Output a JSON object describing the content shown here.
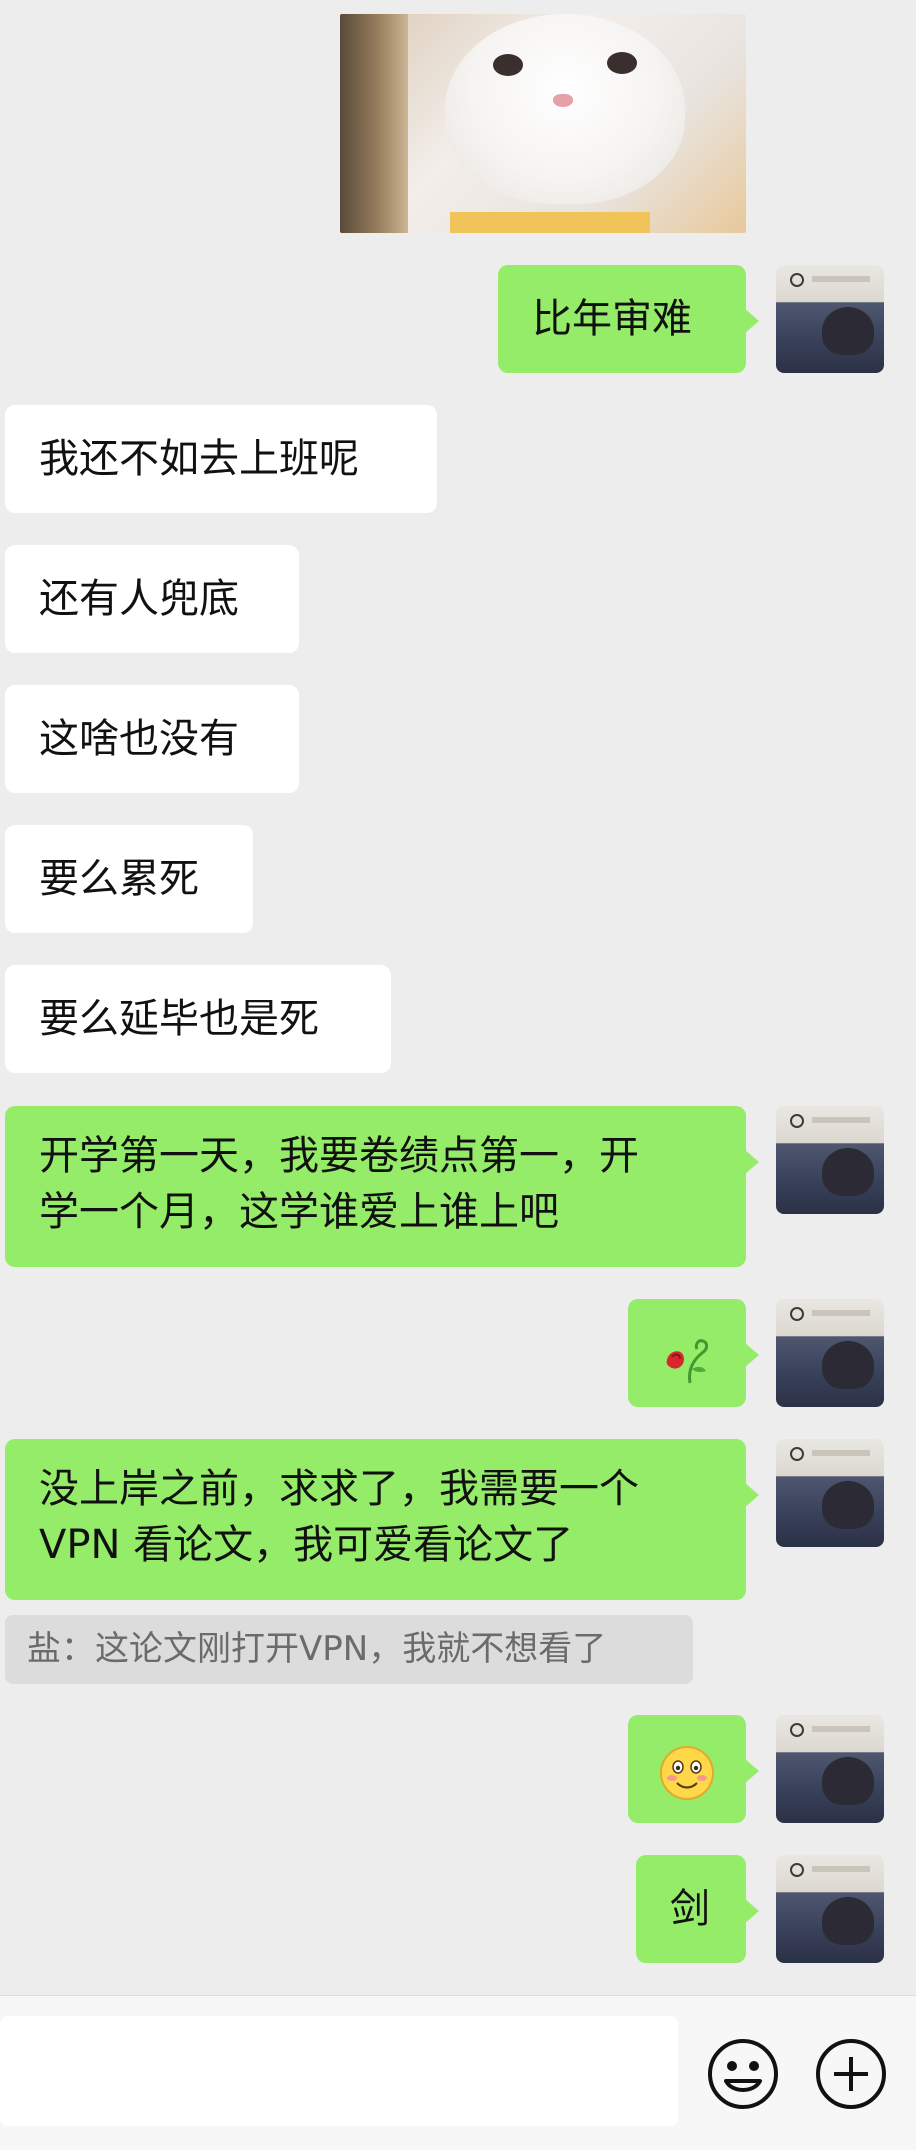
{
  "messages": [
    {
      "id": "m1",
      "text": "比年审难"
    },
    {
      "id": "m2",
      "text": "我还不如去上班呢"
    },
    {
      "id": "m3",
      "text": "还有人兜底"
    },
    {
      "id": "m4",
      "text": "这啥也没有"
    },
    {
      "id": "m5",
      "text": "要么累死"
    },
    {
      "id": "m6",
      "text": "要么延毕也是死"
    },
    {
      "id": "m7",
      "text": "开学第一天，我要卷绩点第一，开\n学一个月，这学谁爱上谁上吧"
    },
    {
      "id": "m8",
      "emoji": "wilted-rose"
    },
    {
      "id": "m9",
      "text": "没上岸之前，求求了，我需要一个\nVPN 看论文，我可爱看论文了"
    },
    {
      "id": "m10",
      "emoji": "flushed-smile"
    },
    {
      "id": "m11",
      "text": "剑"
    }
  ],
  "quote": {
    "text": "盐：这论文刚打开VPN，我就不想看了"
  },
  "input_bar": {
    "icons": [
      "emoji-icon",
      "plus-icon"
    ]
  },
  "colors": {
    "background": "#ededed",
    "outgoing_bubble": "#95ec69",
    "incoming_bubble": "#ffffff",
    "quote_bg": "#dcdcdc"
  }
}
